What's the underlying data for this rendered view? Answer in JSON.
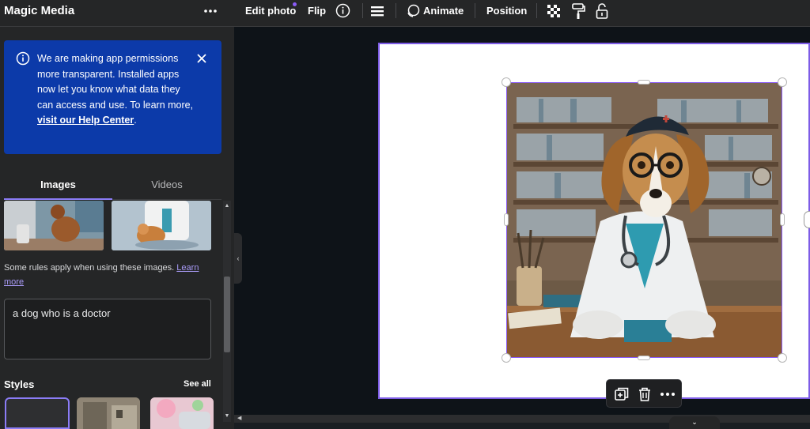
{
  "panel": {
    "title": "Magic Media",
    "more_label": "•••",
    "notice": {
      "line1": "We are making app permissions more transparent. Installed apps now let you know what data they can access and use. To learn more, ",
      "link": "visit our Help Center",
      "end": "."
    },
    "tabs": [
      {
        "label": "Images",
        "active": true
      },
      {
        "label": "Videos",
        "active": false
      }
    ],
    "rules_text": "Some rules apply when using these images. ",
    "rules_link": "Learn more",
    "prompt_value": "a dog who is a doctor",
    "styles_label": "Styles",
    "see_all_label": "See all"
  },
  "toolbar": {
    "edit_photo": "Edit photo",
    "flip": "Flip",
    "animate": "Animate",
    "position": "Position"
  },
  "colors": {
    "accent": "#8b5cf6",
    "notice_bg": "#0c3aa9",
    "panel_bg": "#252627",
    "canvas_bg": "#0e1318"
  },
  "icons": [
    "more-dots-icon",
    "info-icon",
    "close-icon",
    "menu-lines-icon",
    "animate-icon",
    "transparency-icon",
    "paint-roller-icon",
    "lock-icon",
    "duplicate-icon",
    "trash-icon",
    "chevron-left-icon",
    "chevron-down-icon"
  ]
}
